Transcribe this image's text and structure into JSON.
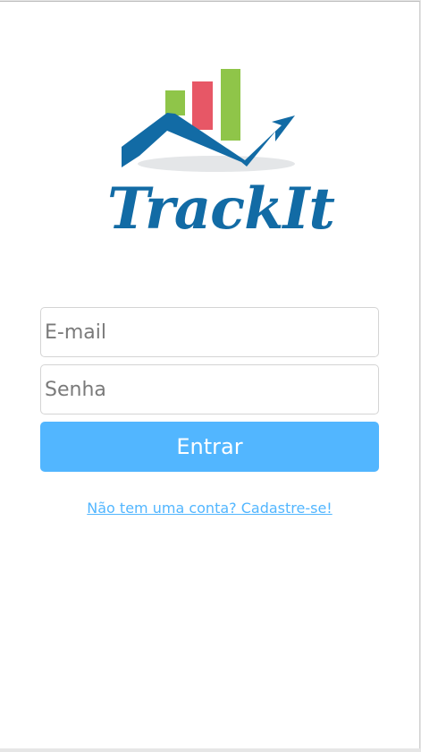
{
  "brand": {
    "name": "TrackIt",
    "colors": {
      "primary": "#126ba5",
      "green": "#8fc549",
      "red": "#e75766",
      "shadow": "#e4e6e8"
    }
  },
  "login": {
    "email_placeholder": "E-mail",
    "password_placeholder": "Senha",
    "submit_label": "Entrar",
    "signup_link": "Não tem uma conta? Cadastre-se!"
  },
  "theme": {
    "accent": "#52b6ff",
    "background": "#ffffff"
  }
}
